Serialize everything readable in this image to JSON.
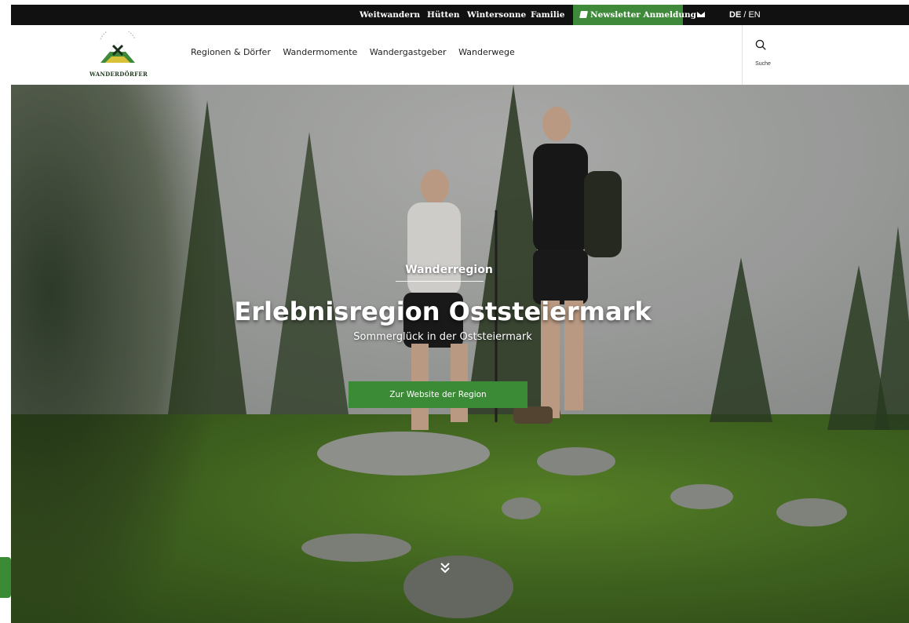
{
  "topbar": {
    "links": [
      "Weitwandern",
      "Hütten",
      "Wintersonne",
      "Familie"
    ],
    "newsletter_label": "Newsletter Anmeldung",
    "mail_icon": "envelope-icon",
    "lang_active": "DE",
    "lang_separator": " / ",
    "lang_other": "EN"
  },
  "header": {
    "logo_text": "WANDERDÖRFER",
    "nav": [
      "Regionen & Dörfer",
      "Wandermomente",
      "Wandergastgeber",
      "Wanderwege"
    ],
    "search_label": "Suche"
  },
  "hero": {
    "kicker": "Wanderregion",
    "title": "Erlebnisregion Oststeiermark",
    "subtitle": "Sommerglück in der Oststeiermark",
    "button_label": "Zur Website der Region",
    "scroll_icon": "double-chevron-down-icon"
  },
  "colors": {
    "brand_green": "#3b8a36",
    "topbar_bg": "#111111"
  }
}
